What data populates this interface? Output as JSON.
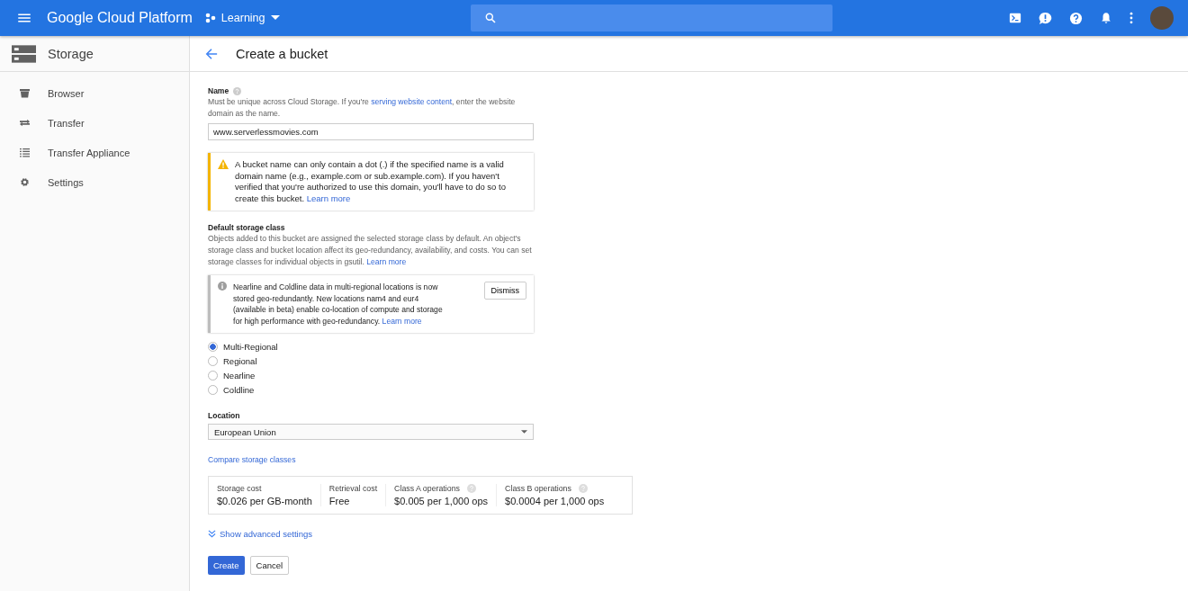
{
  "header": {
    "brand": "Google Cloud Platform",
    "project": "Learning"
  },
  "sidebar": {
    "title": "Storage",
    "items": [
      {
        "label": "Browser"
      },
      {
        "label": "Transfer"
      },
      {
        "label": "Transfer Appliance"
      },
      {
        "label": "Settings"
      }
    ]
  },
  "page_title": "Create a bucket",
  "name_field": {
    "label": "Name",
    "help_before": "Must be unique across Cloud Storage. If you're ",
    "help_link": "serving website content",
    "help_after": ", enter the website domain as the name.",
    "value": "www.serverlessmovies.com"
  },
  "warning": {
    "text": "A bucket name can only contain a dot (.) if the specified name is a valid domain name (e.g., example.com or sub.example.com). If you haven't verified that you're authorized to use this domain, you'll have to do so to create this bucket. ",
    "link": "Learn more"
  },
  "storage_class": {
    "label": "Default storage class",
    "description": "Objects added to this bucket are assigned the selected storage class by default. An object's storage class and bucket location affect its geo-redundancy, availability, and costs. You can set storage classes for individual objects in gsutil. ",
    "link": "Learn more",
    "notice": {
      "text": "Nearline and Coldline data in multi-regional locations is now stored geo-redundantly. New locations nam4 and eur4 (available in beta) enable co-location of compute and storage for high performance with geo-redundancy. ",
      "link": "Learn more",
      "dismiss": "Dismiss"
    },
    "options": [
      {
        "label": "Multi-Regional",
        "selected": true
      },
      {
        "label": "Regional",
        "selected": false
      },
      {
        "label": "Nearline",
        "selected": false
      },
      {
        "label": "Coldline",
        "selected": false
      }
    ]
  },
  "location": {
    "label": "Location",
    "value": "European Union"
  },
  "compare_link": "Compare storage classes",
  "costs": [
    {
      "label": "Storage cost",
      "value": "$0.026 per GB-month",
      "help": false
    },
    {
      "label": "Retrieval cost",
      "value": "Free",
      "help": false
    },
    {
      "label": "Class A operations",
      "value": "$0.005 per 1,000 ops",
      "help": true
    },
    {
      "label": "Class B operations",
      "value": "$0.0004 per 1,000 ops",
      "help": true
    }
  ],
  "advanced_link": "Show advanced settings",
  "buttons": {
    "create": "Create",
    "cancel": "Cancel"
  }
}
